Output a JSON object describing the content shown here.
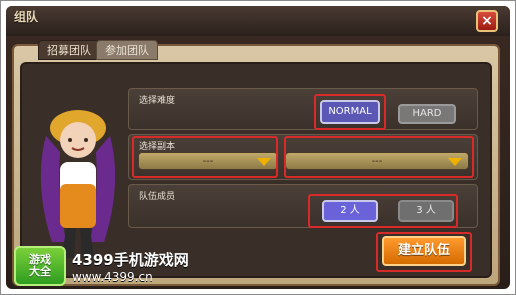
{
  "window": {
    "title": "组队",
    "close_label": "×"
  },
  "tabs": [
    {
      "label": "招募团队",
      "active": true
    },
    {
      "label": "参加团队",
      "active": false
    }
  ],
  "difficulty": {
    "title": "选择难度",
    "options": [
      "NORMAL",
      "HARD"
    ],
    "selected": "NORMAL"
  },
  "dungeon": {
    "title": "选择副本",
    "left_value": "---",
    "right_value": "---"
  },
  "members": {
    "title": "队伍成员",
    "options": [
      "2 人",
      "3 人"
    ],
    "selected": "2 人"
  },
  "actions": {
    "create_label": "建立队伍"
  },
  "watermark": {
    "badge_line1": "游戏",
    "badge_line2": "大全",
    "brand": "4399手机游戏网",
    "url": "www.4399.cn"
  },
  "colors": {
    "accent_orange": "#d46b00",
    "selected_blue": "#5a58b4",
    "highlight_red": "#d92a2a"
  }
}
